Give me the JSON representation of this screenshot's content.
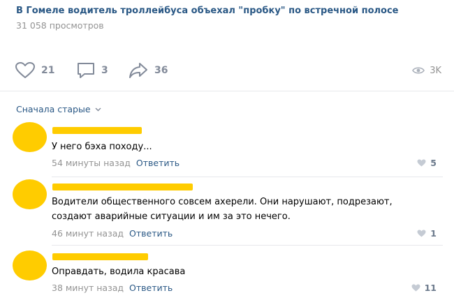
{
  "post": {
    "title": "В Гомеле водитель троллейбуса объехал \"пробку\" по встречной полосе",
    "views": "31 058 просмотров"
  },
  "actions": {
    "likes": "21",
    "comments": "3",
    "shares": "36",
    "seen": "3K"
  },
  "sort_label": "Сначала старые",
  "comments": [
    {
      "text": "У него бэха походу...",
      "time": "54 минуты назад",
      "reply": "Ответить",
      "likes": "5"
    },
    {
      "text_line1": "Водители общественного совсем ахерели. Они нарушают, подрезают,",
      "text_line2": "создают аварийные ситуации и им за это нечего.",
      "time": "46 минут назад",
      "reply": "Ответить",
      "likes": "1"
    },
    {
      "text": "Оправдать, водила красава",
      "time": "38 минут назад",
      "reply": "Ответить",
      "likes": "11"
    }
  ],
  "colors": {
    "link": "#2a5885",
    "redaction": "#ffcc00",
    "muted": "#939393"
  }
}
